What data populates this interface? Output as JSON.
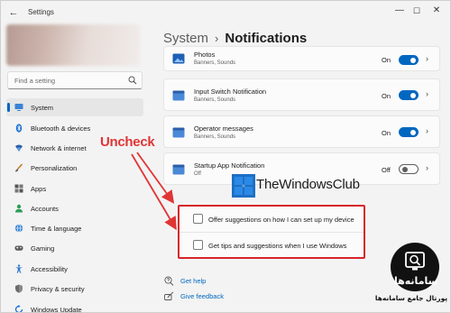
{
  "window": {
    "title": "Settings",
    "back_glyph": "←",
    "minimize": "—",
    "maximize": "☐",
    "close": "✕"
  },
  "sidebar": {
    "search_placeholder": "Find a setting",
    "items": [
      {
        "label": "System",
        "icon": "monitor-icon",
        "selected": true
      },
      {
        "label": "Bluetooth & devices",
        "icon": "bluetooth-icon"
      },
      {
        "label": "Network & internet",
        "icon": "network-icon"
      },
      {
        "label": "Personalization",
        "icon": "brush-icon"
      },
      {
        "label": "Apps",
        "icon": "apps-icon"
      },
      {
        "label": "Accounts",
        "icon": "person-icon"
      },
      {
        "label": "Time & language",
        "icon": "globe-icon"
      },
      {
        "label": "Gaming",
        "icon": "gamepad-icon"
      },
      {
        "label": "Accessibility",
        "icon": "accessibility-icon"
      },
      {
        "label": "Privacy & security",
        "icon": "shield-icon"
      },
      {
        "label": "Windows Update",
        "icon": "update-icon"
      }
    ]
  },
  "breadcrumb": {
    "parent": "System",
    "separator": "›",
    "current": "Notifications"
  },
  "notifications": [
    {
      "title": "Photos",
      "subtitle": "Banners, Sounds",
      "state": "On",
      "on": true,
      "icon": "photos-icon"
    },
    {
      "title": "Input Switch Notification",
      "subtitle": "Banners, Sounds",
      "state": "On",
      "on": true,
      "icon": "app-icon"
    },
    {
      "title": "Operator messages",
      "subtitle": "Banners, Sounds",
      "state": "On",
      "on": true,
      "icon": "app-icon"
    },
    {
      "title": "Startup App Notification",
      "subtitle": "Off",
      "state": "Off",
      "on": false,
      "icon": "app-icon"
    }
  ],
  "chevron": "›",
  "checkboxes": [
    {
      "label": "Offer suggestions on how I can set up my device",
      "checked": false
    },
    {
      "label": "Get tips and suggestions when I use Windows",
      "checked": false
    }
  ],
  "annotation": {
    "text": "Uncheck",
    "color": "#e03535"
  },
  "watermark": {
    "text": "TheWindowsClub"
  },
  "links": [
    {
      "label": "Get help",
      "icon": "help-icon"
    },
    {
      "label": "Give feedback",
      "icon": "feedback-icon"
    }
  ],
  "corner_logo": {
    "title": "سامانه‌ها",
    "subtitle": "پورتال جامع سامانه‌ها"
  },
  "colors": {
    "accent": "#0067c0",
    "highlight_red": "#d6262a",
    "window_bg": "#f3f3f3",
    "card_bg": "#fbfbfb"
  }
}
